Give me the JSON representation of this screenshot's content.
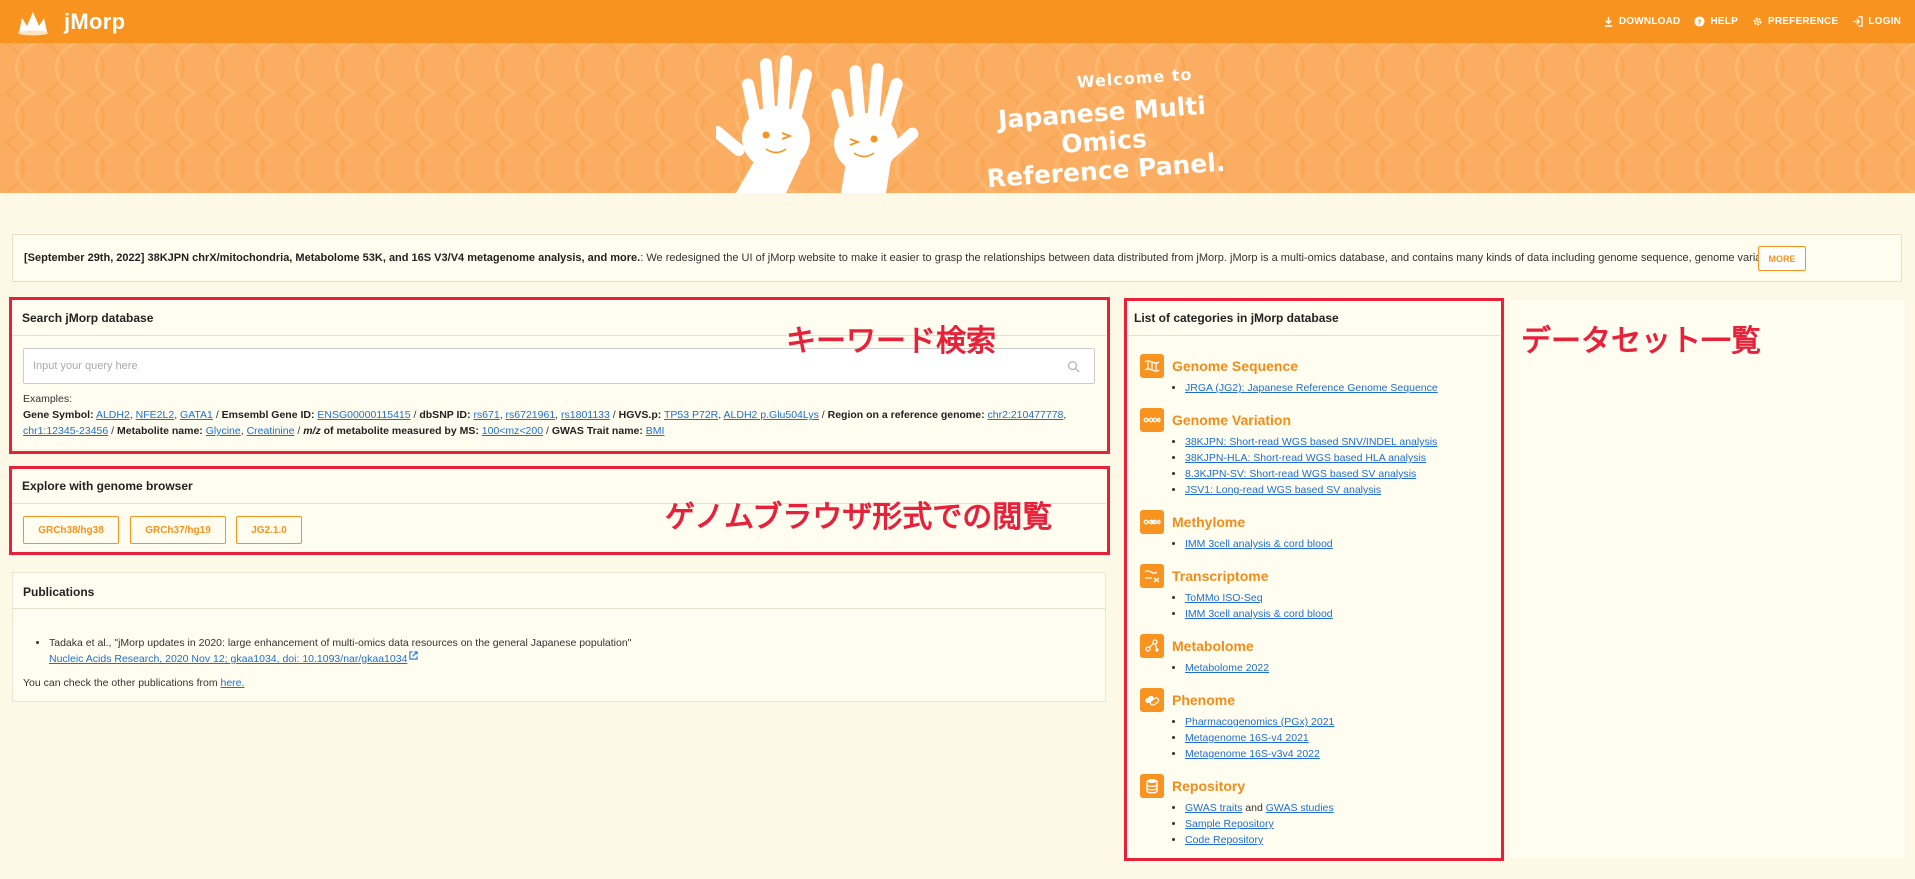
{
  "header": {
    "brand": "jMorp",
    "nav": [
      {
        "label": "DOWNLOAD",
        "icon": "download-icon"
      },
      {
        "label": "HELP",
        "icon": "help-icon"
      },
      {
        "label": "PREFERENCE",
        "icon": "gear-icon"
      },
      {
        "label": "LOGIN",
        "icon": "login-icon"
      }
    ]
  },
  "hero": {
    "welcome": "Welcome to",
    "title_line1": "Japanese Multi Omics",
    "title_line2": "Reference Panel."
  },
  "announcement": {
    "headline": "[September 29th, 2022] 38KJPN chrX/mitochondria, Metabolome 53K, and 16S V3/V4 metagenome analysis, and more.",
    "body": ": We redesigned the UI of jMorp website to make it easier to grasp the relationships between data distributed from jMorp. jMorp is a multi-omics database, and contains many kinds of data including genome sequence, genome variati...",
    "more_label": "MORE"
  },
  "search": {
    "title": "Search jMorp database",
    "placeholder": "Input your query here",
    "examples_label": "Examples:",
    "gene_symbol_label": "Gene Symbol:",
    "gene_symbols": [
      "ALDH2",
      "NFE2L2",
      "GATA1"
    ],
    "ensembl_label": "Emsembl Gene ID:",
    "ensembl_ids": [
      "ENSG00000115415"
    ],
    "dbsnp_label": "dbSNP ID:",
    "dbsnp_ids": [
      "rs671",
      "rs6721961",
      "rs1801133"
    ],
    "hgvs_label": "HGVS.p:",
    "hgvs": [
      "TP53 P72R",
      "ALDH2 p.Glu504Lys"
    ],
    "region_label": "Region on a reference genome:",
    "regions": [
      "chr2:210477778",
      "chr1:12345-23456"
    ],
    "metabolite_label": "Metabolite name:",
    "metabolites": [
      "Glycine",
      "Creatinine"
    ],
    "mz_label_pre": "m/z",
    "mz_label_post": "of metabolite measured by MS:",
    "mz_values": [
      "100<mz<200"
    ],
    "gwas_label": "GWAS Trait name:",
    "gwas_traits": [
      "BMI"
    ]
  },
  "browser": {
    "title": "Explore with genome browser",
    "buttons": [
      "GRCh38/hg38",
      "GRCh37/hg19",
      "JG2.1.0"
    ]
  },
  "publications": {
    "title": "Publications",
    "items": [
      {
        "text": "Tadaka et al., \"jMorp updates in 2020: large enhancement of multi-omics data resources on the general Japanese population\"",
        "link": "Nucleic Acids Research, 2020 Nov 12; gkaa1034, doi: 10.1093/nar/gkaa1034"
      }
    ],
    "note_prefix": "You can check the other publications from",
    "note_link": "here."
  },
  "categories": {
    "title": "List of categories in jMorp database",
    "groups": [
      {
        "name": "Genome Sequence",
        "items": [
          "JRGA (JG2): Japanese Reference Genome Sequence"
        ]
      },
      {
        "name": "Genome Variation",
        "items": [
          "38KJPN: Short-read WGS based SNV/INDEL analysis",
          "38KJPN-HLA: Short-read WGS based HLA analysis",
          "8.3KJPN-SV: Short-read WGS based SV analysis",
          "JSV1: Long-read WGS based SV analysis"
        ]
      },
      {
        "name": "Methylome",
        "items": [
          "IMM 3cell analysis & cord blood"
        ]
      },
      {
        "name": "Transcriptome",
        "items": [
          "ToMMo ISO-Seq",
          "IMM 3cell analysis & cord blood"
        ]
      },
      {
        "name": "Metabolome",
        "items": [
          "Metabolome 2022"
        ]
      },
      {
        "name": "Phenome",
        "items": [
          "Pharmacogenomics (PGx) 2021",
          "Metagenome 16S-v4 2021",
          "Metagenome 16S-v3v4 2022"
        ]
      },
      {
        "name": "Repository",
        "items": [
          "GWAS traits",
          "GWAS studies",
          "Sample Repository",
          "Code Repository"
        ],
        "joiner": "and"
      }
    ]
  },
  "annotations": {
    "keyword_search": "キーワード検索",
    "genome_browser": "ゲノムブラウザ形式での閲覧",
    "dataset_list": "データセット一覧"
  },
  "colors": {
    "brand_orange": "#f7931e",
    "hero_orange": "#fbae62",
    "annotation_red": "#e8213b",
    "link_blue": "#1e6fd0"
  }
}
